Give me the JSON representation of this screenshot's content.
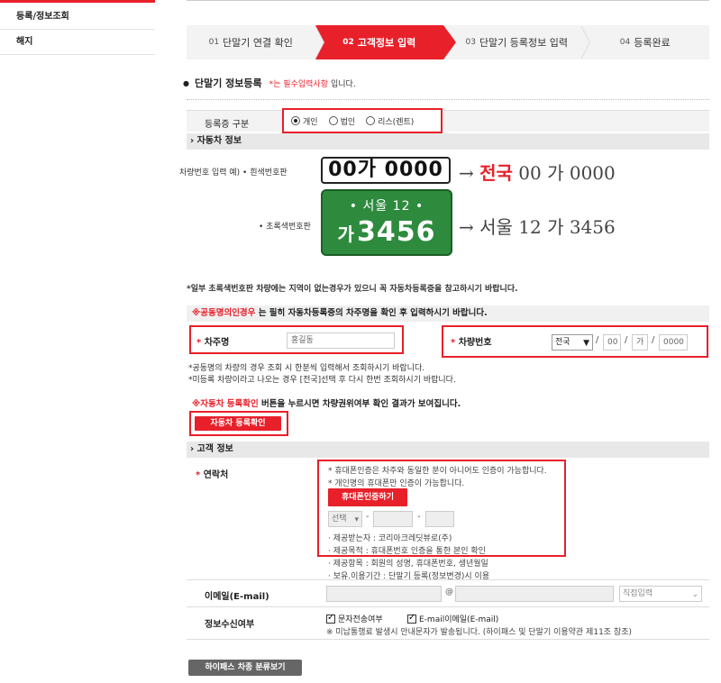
{
  "sidebar": {
    "items": [
      {
        "label": "등록/정보조회"
      },
      {
        "label": "해지"
      }
    ]
  },
  "steps": [
    {
      "num": "01",
      "label": "단말기 연결 확인"
    },
    {
      "num": "02",
      "label": "고객정보 입력"
    },
    {
      "num": "03",
      "label": "단말기 등록정보 입력"
    },
    {
      "num": "04",
      "label": "등록완료"
    }
  ],
  "form": {
    "title": "단말기 정보등록",
    "required_note": "*는 필수입력사항",
    "required_tail": "입니다.",
    "reg_type_label": "등록증 구분",
    "reg_types": [
      "개인",
      "법인",
      "리스(렌트)"
    ],
    "reg_type_selected": "개인"
  },
  "vehicle": {
    "header": "› 자동차 정보",
    "example_label": "차량번호 입력 예) • 흰색번호판",
    "white_plate": "00가 0000",
    "white_result_prefix": "→",
    "white_result_red": "전국",
    "white_result_rest": "00 가 0000",
    "green_label": "• 초록색번호판",
    "green_plate_top": "•  서울 12  •",
    "green_plate_ga": "가",
    "green_plate_num": "3456",
    "green_result": "→ 서울 12 가 3456",
    "note_green": "*일부 초록색번호판 차량에는 지역이 없는경우가 있으니 꼭 자동차등록증을 참고하시기 바랍니다.",
    "notice_joint_red": "※공동명의인경우",
    "notice_joint_rest": " 는 필히 자동차등록증의 차주명을 확인 후 입력하시기 바랍니다.",
    "owner_label": "차주명",
    "owner_value": "홍길동",
    "carno_label": "차량번호",
    "carno_region": "전국",
    "carno_1": "00",
    "carno_2": "가",
    "carno_3": "0000",
    "note_1": "*공동명의 차량의 경우 조회 시 한분씩 입력해서 조회하시기 바랍니다.",
    "note_2": "*미등록 차량이라고 나오는 경우 [전국]선택 후 다시 한번 조회하시기 바랍니다.",
    "notice_check_red": "※자동차 등록확인",
    "notice_check_rest": " 버튼을 누르시면 차량권위여부 확인 결과가 보여집니다.",
    "check_button": "자동차 등록확인"
  },
  "customer": {
    "header": "› 고객 정보",
    "contact_label": "연락처",
    "contact_note_1": "* 휴대폰인증은 차주와 동일한 분이 아니어도 인증이 가능합니다.",
    "contact_note_2": "* 개인명의 휴대폰만 인증이 가능합니다.",
    "auth_button": "휴대폰인증하기",
    "phone_select": "선택",
    "provider_1": "· 제공받는자 : 코리아크레딧뷰로(주)",
    "provider_2": "· 제공목적 : 휴대폰번호 인증을 통한 본인 확인",
    "provider_3": "· 제공항목 : 회원의 성명, 휴대폰번호, 생년월일",
    "provider_4": "· 보유.이용기간 : 단말기 등록(정보변경)시 이용",
    "email_label": "이메일(E-mail)",
    "email_at": "@",
    "email_domain_select": "직접입력",
    "consent_label": "정보수신여부",
    "consent_sms": "문자전송여부",
    "consent_email": "E-mail이메일(E-mail)",
    "consent_note": "※ 미납통행료 발생시 안내문자가 발송됩니다. (하이패스 및 단말기 이용약관 제11조 참조)"
  },
  "footer_button": "하이패스 차종 분류보기",
  "colors": {
    "accent": "#e8202a",
    "plate_green": "#2e8b3e"
  }
}
